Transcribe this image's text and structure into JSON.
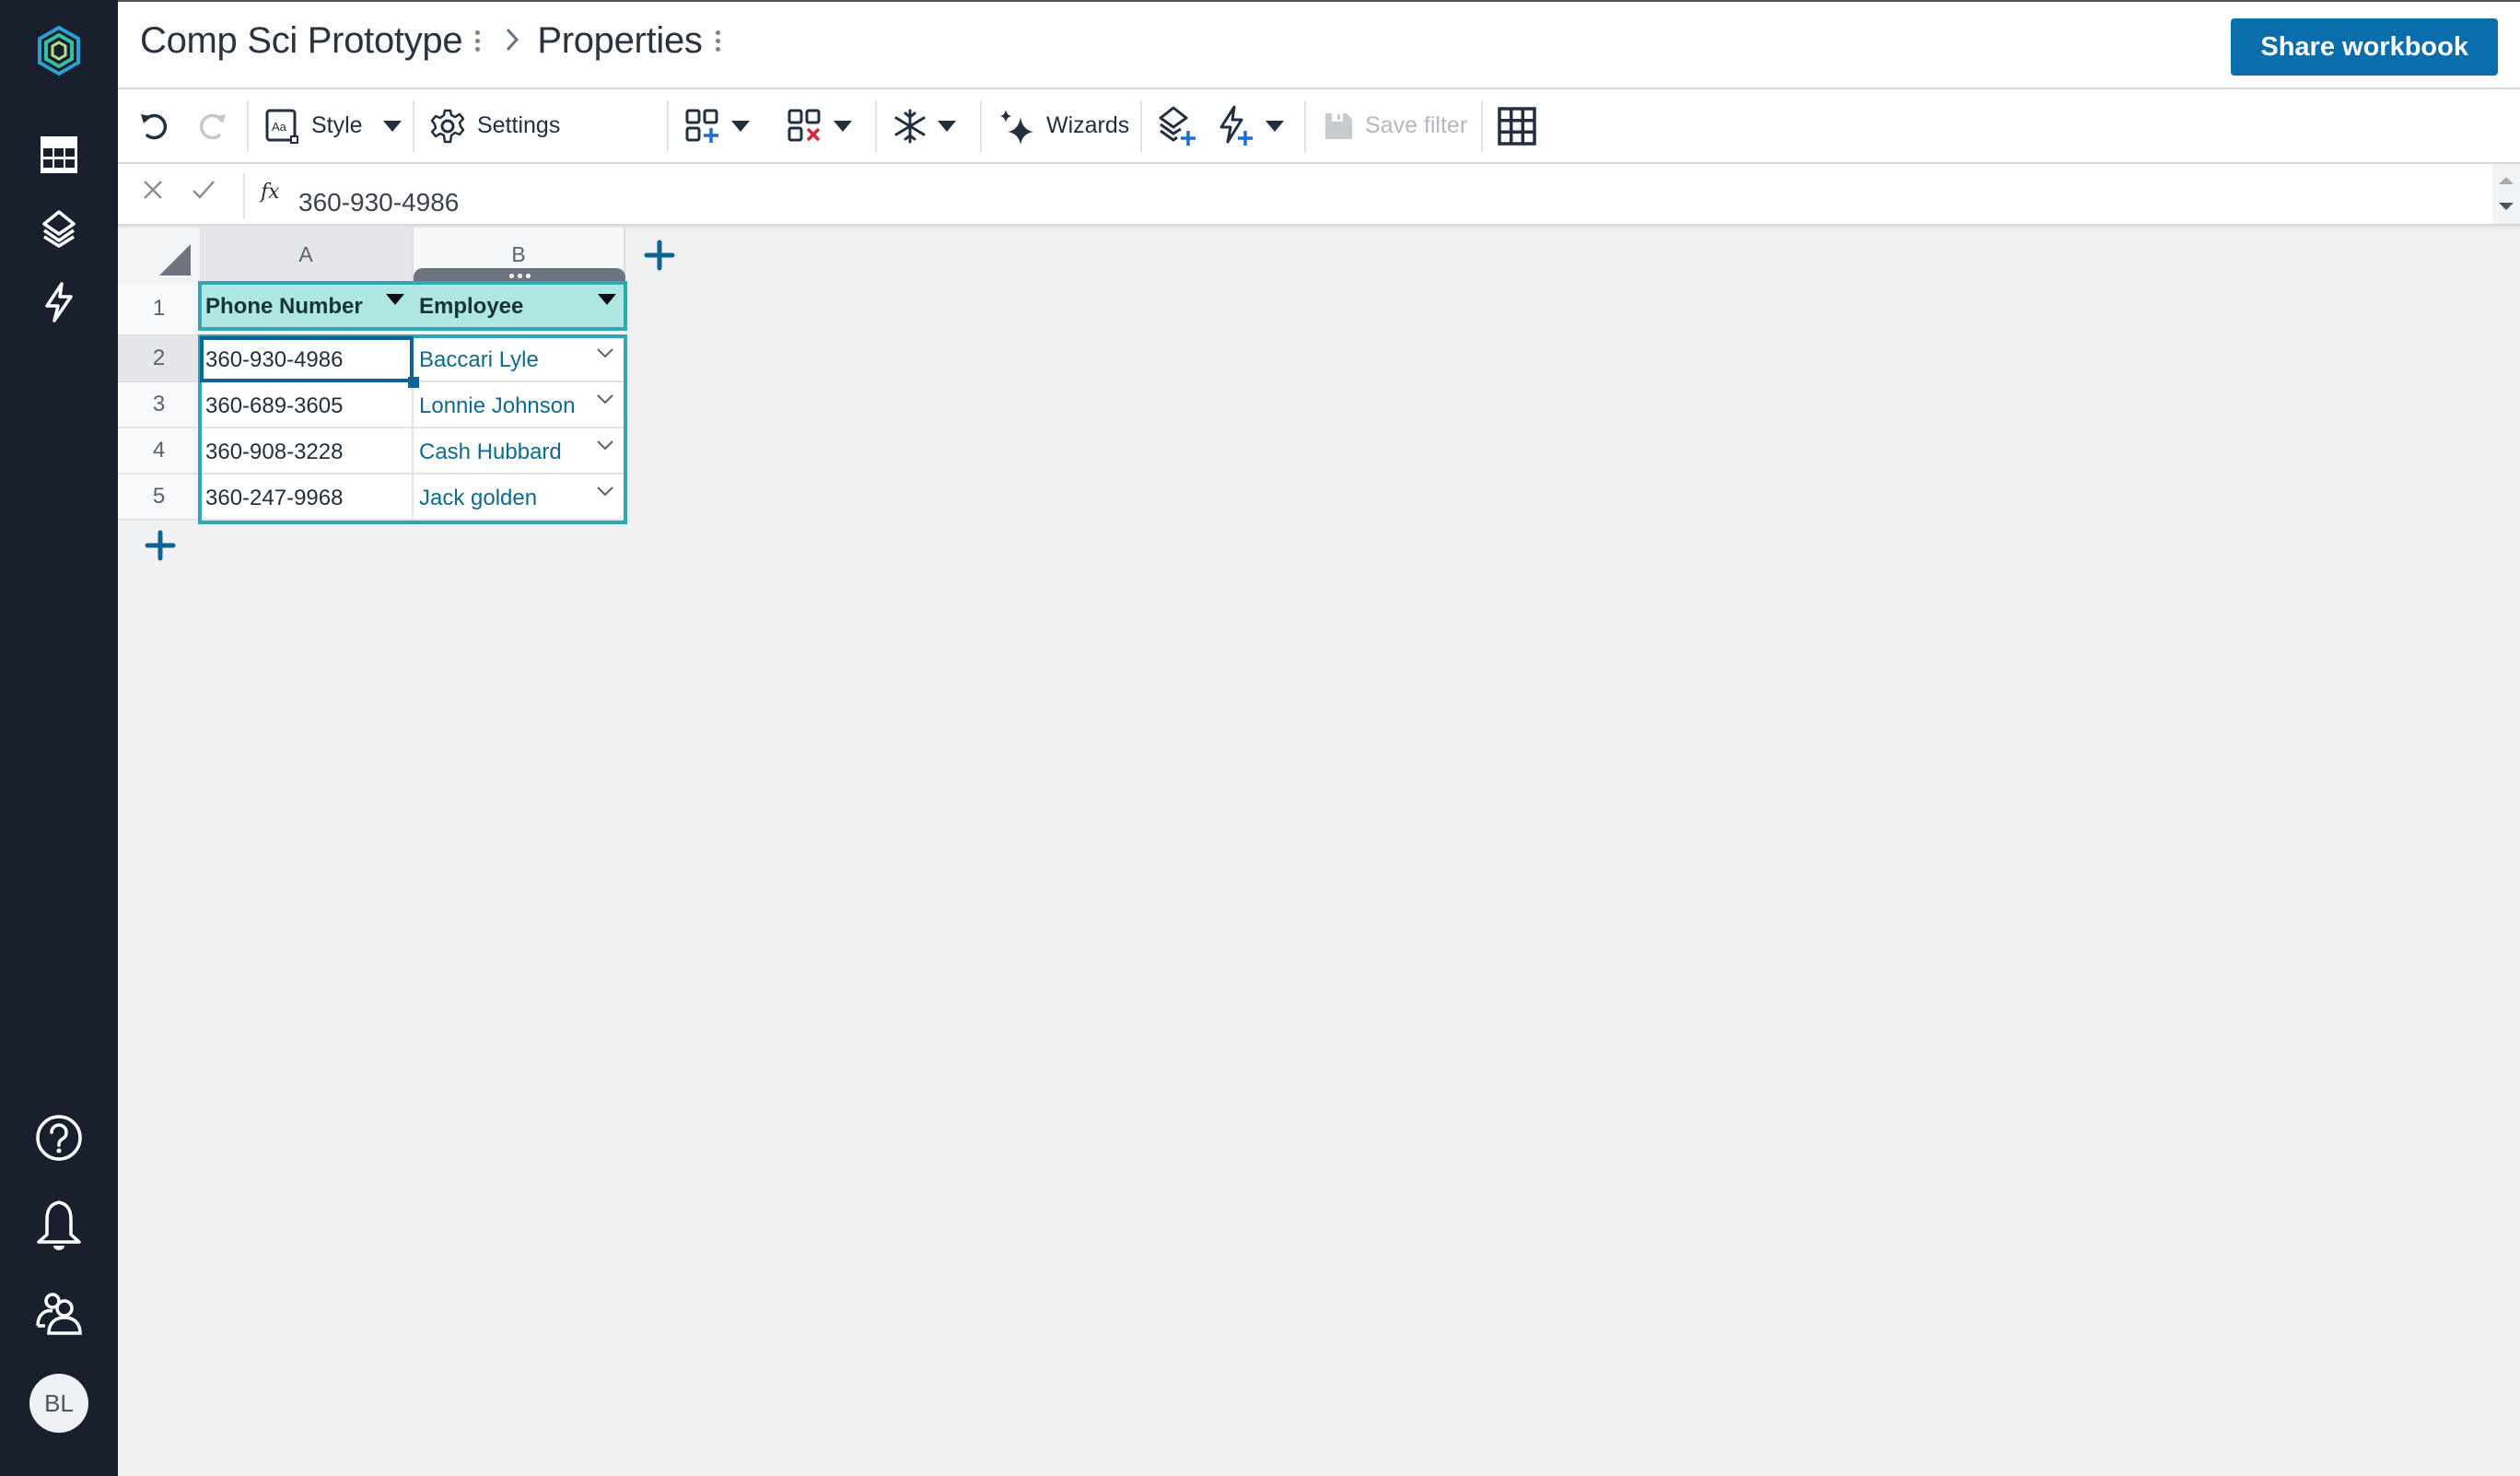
{
  "sidebar": {
    "logo": "app-logo-hexagon",
    "items": [
      {
        "name": "sheets",
        "icon": "table-grid-icon"
      },
      {
        "name": "data",
        "icon": "layers-icon"
      },
      {
        "name": "automations",
        "icon": "lightning-icon"
      }
    ],
    "bottom_items": [
      {
        "name": "help",
        "icon": "help-circle-icon"
      },
      {
        "name": "notifications",
        "icon": "bell-icon"
      },
      {
        "name": "sharing",
        "icon": "users-icon"
      }
    ],
    "avatar_initials": "BL"
  },
  "header": {
    "workbook_title": "Comp Sci Prototype",
    "separator": "›",
    "sheet_title": "Properties",
    "share_button": "Share workbook"
  },
  "toolbar": {
    "undo": "undo-icon",
    "redo": "redo-icon",
    "style_label": "Style",
    "settings_label": "Settings",
    "insert_icon": "add-blocks-icon",
    "delete_icon": "delete-blocks-icon",
    "freeze_icon": "freeze-snowflake-icon",
    "wizards_label": "Wizards",
    "add_data_icon": "add-layers-icon",
    "add_automation_icon": "add-automation-icon",
    "save_filter_label": "Save filter",
    "gridlines_icon": "grid-icon"
  },
  "formula_bar": {
    "fx_label": "fx",
    "value": "360-930-4986"
  },
  "grid": {
    "columns": [
      "A",
      "B"
    ],
    "row_numbers": [
      "1",
      "2",
      "3",
      "4",
      "5"
    ],
    "active_cell": "A2",
    "headers": [
      "Phone Number",
      "Employee"
    ],
    "rows": [
      {
        "phone": "360-930-4986",
        "employee": "Baccari Lyle"
      },
      {
        "phone": "360-689-3605",
        "employee": "Lonnie Johnson"
      },
      {
        "phone": "360-908-3228",
        "employee": "Cash Hubbard"
      },
      {
        "phone": "360-247-9968",
        "employee": "Jack golden"
      }
    ]
  },
  "colors": {
    "sidebar_bg": "#19202d",
    "accent_blue": "#0a6ead",
    "table_outline": "#2fa6b1",
    "table_header_bg": "#aee6e1",
    "employee_link": "#0f6a8f",
    "active_cell": "#0d6494"
  }
}
